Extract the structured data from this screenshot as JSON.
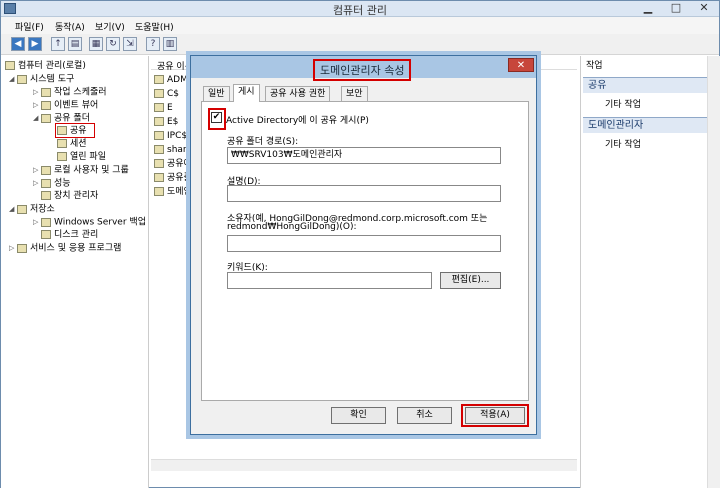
{
  "window": {
    "title": "컴퓨터 관리"
  },
  "menu": [
    "파일(F)",
    "동작(A)",
    "보기(V)",
    "도움말(H)"
  ],
  "tree": {
    "root": "컴퓨터 관리(로컬)",
    "items": [
      {
        "label": "시스템 도구"
      },
      {
        "label": "작업 스케줄러"
      },
      {
        "label": "이벤트 뷰어"
      },
      {
        "label": "공유 폴더"
      },
      {
        "label": "공유"
      },
      {
        "label": "세션"
      },
      {
        "label": "열린 파일"
      },
      {
        "label": "로컬 사용자 및 그룹"
      },
      {
        "label": "성능"
      },
      {
        "label": "장치 관리자"
      },
      {
        "label": "저장소"
      },
      {
        "label": "Windows Server 백업"
      },
      {
        "label": "디스크 관리"
      },
      {
        "label": "서비스 및 응용 프로그램"
      }
    ]
  },
  "middle": {
    "header": "공유 이름",
    "rows": [
      "ADMIN",
      "C$",
      "E",
      "E$",
      "IPC$",
      "shared",
      "공유여",
      "공유폴",
      "도메인"
    ]
  },
  "actions": {
    "header": "작업",
    "sections": [
      {
        "title": "공유",
        "item": "기타 작업"
      },
      {
        "title": "도메인관리자",
        "item": "기타 작업"
      }
    ]
  },
  "dialog": {
    "title": "도메인관리자 속성",
    "close": "✕",
    "tabs": [
      "일반",
      "게시",
      "공유 사용 권한",
      "보안"
    ],
    "publish_label": "Active Directory에 이 공유 게시(P)",
    "publish_checked": true,
    "path_label": "공유 폴더 경로(S):",
    "path_value": "₩₩SRV103₩도메인관리자",
    "desc_label": "설명(D):",
    "desc_value": "",
    "owner_label_1": "소유자(예, HongGilDong@redmond.corp.microsoft.com 또는",
    "owner_label_2": "redmond₩HongGilDong)(O):",
    "owner_value": "",
    "keyword_label": "키워드(K):",
    "keyword_value": "",
    "edit_button": "편집(E)...",
    "ok": "확인",
    "cancel": "취소",
    "apply": "적용(A)"
  }
}
